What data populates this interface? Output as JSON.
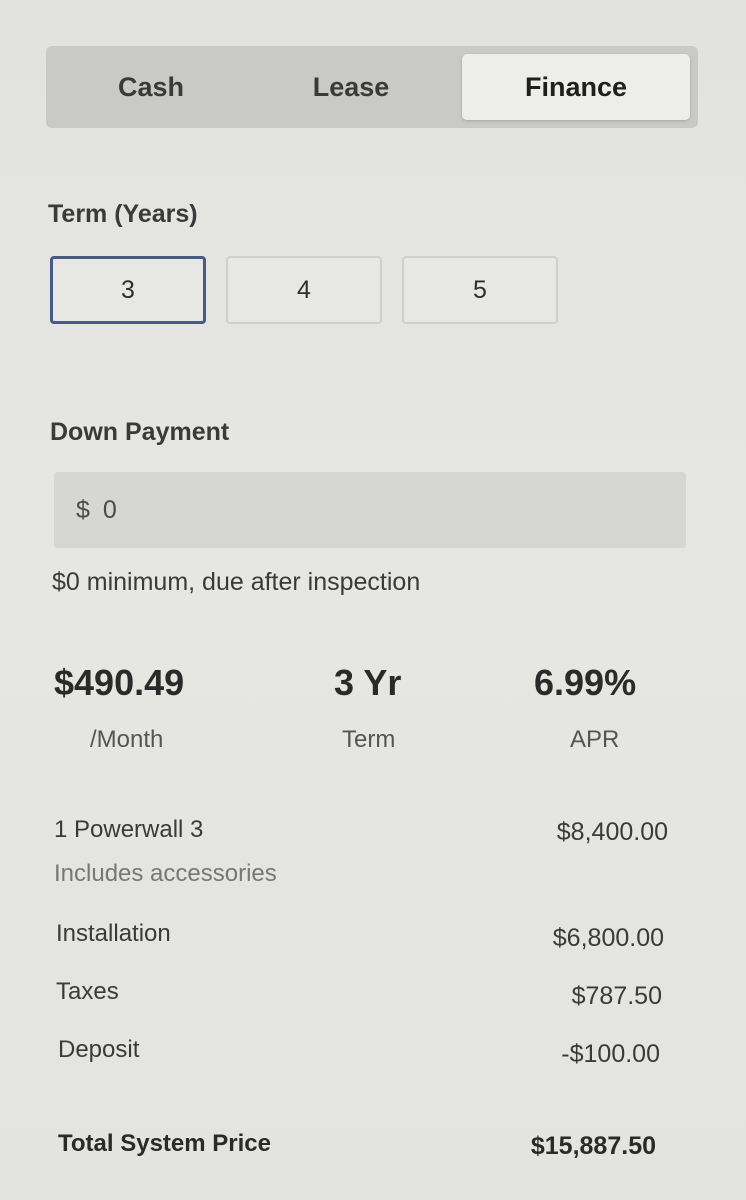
{
  "payment_tabs": {
    "cash": "Cash",
    "lease": "Lease",
    "finance": "Finance",
    "selected": "Finance"
  },
  "term": {
    "label": "Term (Years)",
    "options": [
      "3",
      "4",
      "5"
    ],
    "selected": "3"
  },
  "down_payment": {
    "label": "Down Payment",
    "value": "$ 0",
    "hint": "$0 minimum, due after inspection"
  },
  "summary": {
    "monthly": {
      "value": "$490.49",
      "sub": "/Month"
    },
    "term": {
      "value": "3 Yr",
      "sub": "Term"
    },
    "apr": {
      "value": "6.99%",
      "sub": "APR"
    }
  },
  "line_items": {
    "powerwall": {
      "label": "1 Powerwall 3",
      "sub": "Includes accessories",
      "amount": "$8,400.00"
    },
    "installation": {
      "label": "Installation",
      "amount": "$6,800.00"
    },
    "taxes": {
      "label": "Taxes",
      "amount": "$787.50"
    },
    "deposit": {
      "label": "Deposit",
      "amount": "-$100.00"
    }
  },
  "total": {
    "label": "Total System Price",
    "amount": "$15,887.50"
  },
  "colors": {
    "selected_border": "#4a5a86",
    "segment_bg": "#c9cac7",
    "selected_tab_bg": "#ededeb"
  }
}
